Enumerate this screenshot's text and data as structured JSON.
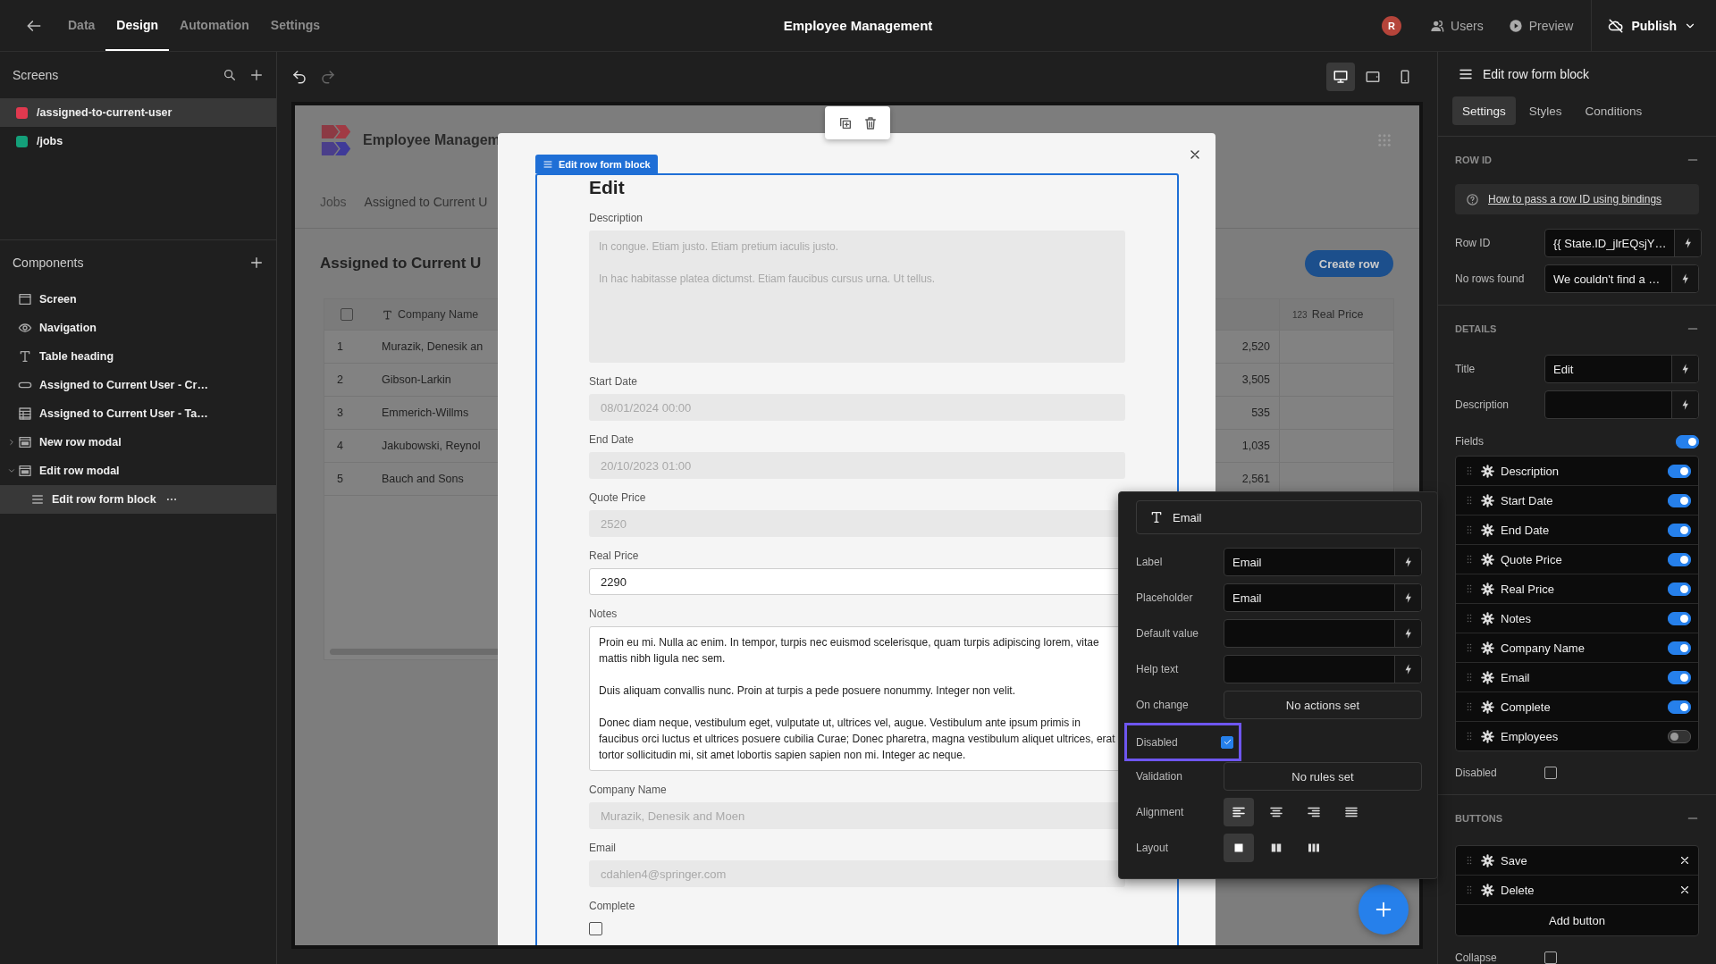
{
  "top_bar": {
    "tabs": [
      {
        "label": "Data",
        "selected": false
      },
      {
        "label": "Design",
        "selected": true
      },
      {
        "label": "Automation",
        "selected": false
      },
      {
        "label": "Settings",
        "selected": false
      }
    ],
    "title": "Employee Management",
    "avatar": "R",
    "actions": [
      {
        "kind": "users",
        "label": "Users"
      },
      {
        "kind": "preview",
        "label": "Preview"
      }
    ],
    "publish": "Publish"
  },
  "screens": {
    "title": "Screens",
    "items": [
      {
        "path": "/assigned-to-current-user",
        "color": "#e0394f",
        "selected": true
      },
      {
        "path": "/jobs",
        "color": "#14a07a",
        "selected": false
      }
    ]
  },
  "components": {
    "title": "Components",
    "items": [
      {
        "kind": "screen",
        "label": "Screen",
        "selected": false
      },
      {
        "kind": "navigation",
        "label": "Navigation",
        "selected": false
      },
      {
        "kind": "heading",
        "label": "Table heading",
        "selected": false
      },
      {
        "kind": "button",
        "label": "Assigned to Current User - Cr…",
        "selected": false
      },
      {
        "kind": "table",
        "label": "Assigned to Current User - Ta…",
        "selected": false
      },
      {
        "kind": "modal",
        "label": "New row modal",
        "selected": false,
        "expanded": false
      },
      {
        "kind": "modal",
        "label": "Edit row modal",
        "selected": false,
        "expanded": true,
        "children": [
          {
            "kind": "form",
            "label": "Edit row form block",
            "selected": true
          }
        ]
      }
    ]
  },
  "canvas_toolbar": {
    "undo_disabled": false,
    "redo_disabled": true,
    "devices": [
      {
        "kind": "desktop",
        "selected": true
      },
      {
        "kind": "tablet",
        "selected": false
      },
      {
        "kind": "mobile",
        "selected": false
      }
    ]
  },
  "preview": {
    "app_name": "Employee Managem",
    "nav": [
      "Jobs",
      "Assigned to Current U"
    ],
    "heading": "Assigned to Current U",
    "create_button": "Create row",
    "table": {
      "checked": false,
      "columns": [
        {
          "kind": "text",
          "label": "Company Name"
        },
        {
          "kind": "number",
          "badge": "123",
          "label": "Real Price"
        }
      ],
      "rows": [
        {
          "index": "1",
          "company": "Murazik, Denesik an",
          "amount": "2,520"
        },
        {
          "index": "2",
          "company": "Gibson-Larkin",
          "amount": "3,505"
        },
        {
          "index": "3",
          "company": "Emmerich-Willms",
          "amount": "535"
        },
        {
          "index": "4",
          "company": "Jakubowski, Reynol",
          "amount": "1,035"
        },
        {
          "index": "5",
          "company": "Bauch and Sons",
          "amount": "2,561"
        }
      ]
    }
  },
  "modal": {
    "tag": "Edit row form block",
    "title": "Edit",
    "fields": [
      {
        "kind": "textarea",
        "label": "Description",
        "disabled": true,
        "value": "In congue. Etiam justo. Etiam pretium iaculis justo.\n\nIn hac habitasse platea dictumst. Etiam faucibus cursus urna. Ut tellus."
      },
      {
        "kind": "input",
        "label": "Start Date",
        "disabled": true,
        "value": "08/01/2024 00:00"
      },
      {
        "kind": "input",
        "label": "End Date",
        "disabled": true,
        "value": "20/10/2023 01:00"
      },
      {
        "kind": "input",
        "label": "Quote Price",
        "disabled": true,
        "value": "2520"
      },
      {
        "kind": "input",
        "label": "Real Price",
        "disabled": false,
        "value": "2290"
      },
      {
        "kind": "textarea",
        "label": "Notes",
        "disabled": false,
        "value": "Proin eu mi. Nulla ac enim. In tempor, turpis nec euismod scelerisque, quam turpis adipiscing lorem, vitae mattis nibh ligula nec sem.\n\nDuis aliquam convallis nunc. Proin at turpis a pede posuere nonummy. Integer non velit.\n\nDonec diam neque, vestibulum eget, vulputate ut, ultrices vel, augue. Vestibulum ante ipsum primis in faucibus orci luctus et ultrices posuere cubilia Curae; Donec pharetra, magna vestibulum aliquet ultrices, erat tortor sollicitudin mi, sit amet lobortis sapien sapien non mi. Integer ac neque."
      },
      {
        "kind": "input",
        "label": "Company Name",
        "disabled": true,
        "value": "Murazik, Denesik and Moen"
      },
      {
        "kind": "input",
        "label": "Email",
        "disabled": true,
        "value": "cdahlen4@springer.com"
      },
      {
        "kind": "checkbox",
        "label": "Complete",
        "checked": false
      }
    ]
  },
  "settings": {
    "title": "Edit row form block",
    "tabs": [
      {
        "label": "Settings",
        "selected": true
      },
      {
        "label": "Styles",
        "selected": false
      },
      {
        "label": "Conditions",
        "selected": false
      }
    ],
    "row_id": {
      "heading": "ROW ID",
      "help": "How to pass a row ID using bindings",
      "rows": [
        {
          "label": "Row ID",
          "value": "{{ State.ID_jlrEQsjY…"
        },
        {
          "label": "No rows found",
          "value": "We couldn't find a …"
        }
      ]
    },
    "details": {
      "heading": "DETAILS",
      "rows": [
        {
          "label": "Title",
          "value": "Edit"
        },
        {
          "label": "Description"
        }
      ],
      "fields_label": "Fields",
      "fields_on": true,
      "fields": [
        {
          "label": "Description",
          "on": true
        },
        {
          "label": "Start Date",
          "on": true
        },
        {
          "label": "End Date",
          "on": true
        },
        {
          "label": "Quote Price",
          "on": true
        },
        {
          "label": "Real Price",
          "on": true
        },
        {
          "label": "Notes",
          "on": true
        },
        {
          "label": "Company Name",
          "on": true
        },
        {
          "label": "Email",
          "on": true
        },
        {
          "label": "Complete",
          "on": true
        },
        {
          "label": "Employees",
          "on": false
        }
      ],
      "disabled_label": "Disabled",
      "disabled": false
    },
    "buttons": {
      "heading": "BUTTONS",
      "items": [
        {
          "label": "Save"
        },
        {
          "label": "Delete"
        }
      ],
      "add": "Add button",
      "collapse_label": "Collapse",
      "collapse": false
    }
  },
  "popover": {
    "title": "Email",
    "rows": [
      {
        "kind": "binding",
        "label": "Label",
        "value": "Email",
        "highlighted": false
      },
      {
        "kind": "binding",
        "label": "Placeholder",
        "value": "Email",
        "highlighted": false
      },
      {
        "kind": "binding",
        "label": "Default value",
        "highlighted": false
      },
      {
        "kind": "binding",
        "label": "Help text",
        "highlighted": false
      },
      {
        "kind": "action",
        "label": "On change",
        "value": "No actions set",
        "highlighted": false
      },
      {
        "kind": "checkbox",
        "label": "Disabled",
        "checked": true,
        "highlighted": true
      },
      {
        "kind": "action",
        "label": "Validation",
        "value": "No rules set",
        "highlighted": false
      },
      {
        "kind": "segmented",
        "label": "Alignment",
        "highlighted": false,
        "options": [
          {
            "kind": "left",
            "selected": true
          },
          {
            "kind": "center",
            "selected": false
          },
          {
            "kind": "right",
            "selected": false
          },
          {
            "kind": "justify",
            "selected": false
          }
        ]
      },
      {
        "kind": "segmented",
        "label": "Layout",
        "highlighted": false,
        "options": [
          {
            "kind": "one",
            "selected": true
          },
          {
            "kind": "two",
            "selected": false
          },
          {
            "kind": "three",
            "selected": false
          }
        ]
      }
    ]
  }
}
